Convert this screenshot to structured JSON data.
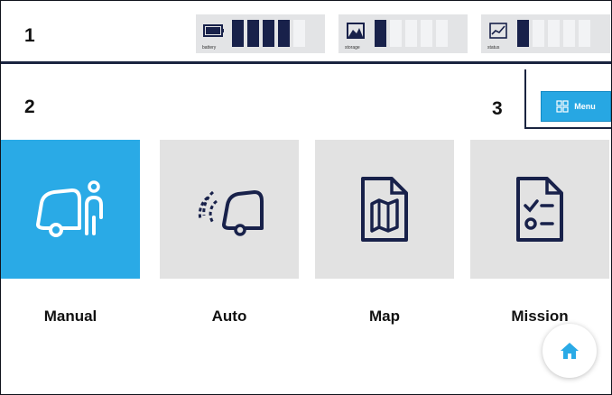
{
  "sections": {
    "one": "1",
    "two": "2",
    "three": "3"
  },
  "status_indicators": [
    {
      "id": "battery",
      "caption": "battery",
      "icon": "battery-icon",
      "level": 4,
      "max": 5
    },
    {
      "id": "storage",
      "caption": "storage",
      "icon": "storage-icon",
      "level": 1,
      "max": 5
    },
    {
      "id": "status",
      "caption": "status",
      "icon": "status-chart-icon",
      "level": 1,
      "max": 5
    }
  ],
  "menu_button": {
    "label": "Menu",
    "icon": "grid-icon"
  },
  "tiles": [
    {
      "id": "manual",
      "label": "Manual",
      "icon": "manual-operator-icon",
      "active": true
    },
    {
      "id": "auto",
      "label": "Auto",
      "icon": "auto-drive-icon",
      "active": false
    },
    {
      "id": "map",
      "label": "Map",
      "icon": "map-icon",
      "active": false
    },
    {
      "id": "mission",
      "label": "Mission",
      "icon": "mission-checklist-icon",
      "active": false
    }
  ],
  "home_button": {
    "icon": "home-icon"
  },
  "colors": {
    "accent": "#2aaae6",
    "tile": "#e2e2e2",
    "dark": "#18214a",
    "indicator_bg": "#e3e4e6"
  }
}
